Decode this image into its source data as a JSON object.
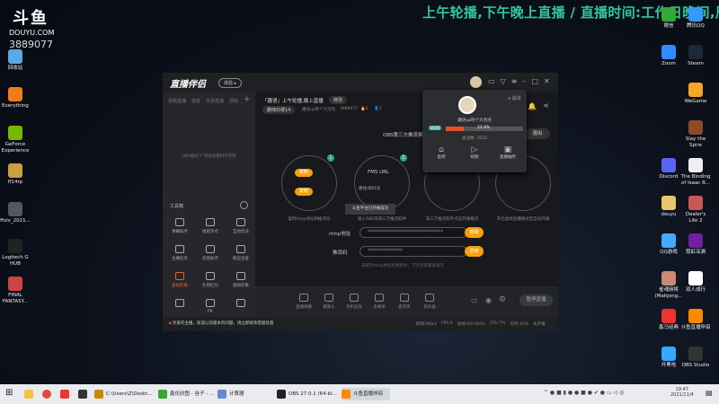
{
  "banner": "上午轮播,下午晚上直播 /  直播时间:工作日晚间,周",
  "logo": {
    "text": "斗鱼",
    "sub": "DOUYU.COM"
  },
  "room_id": "3889077",
  "desktop_left": [
    "回收站",
    "Everything",
    "GeForce Experience",
    "ff14rp",
    "ffxiv_2021...",
    "Logitech G HUB",
    "FINAL FANTASY..."
  ],
  "desktop_right": [
    [
      "微信",
      "腾讯QQ"
    ],
    [
      "Zoom",
      "Steam"
    ],
    [
      "",
      "WeGame"
    ],
    [
      "",
      "Slay the Spire"
    ],
    [
      "Discord",
      "The Binding of Isaac R..."
    ],
    [
      "douyu",
      "Dealer's Life 2"
    ],
    [
      "QQ游戏",
      "霓虹深渊"
    ],
    [
      "雀魂麻将(Mahjong...",
      "双人成行"
    ],
    [
      "鑫马经典",
      "斗鱼直播伴侣"
    ],
    [
      "开黑啦",
      "OBS Studio"
    ]
  ],
  "colors": {
    "accent": "#f6a10c",
    "banner": "#2fc99a",
    "badge": "#2aa37a"
  },
  "app": {
    "title": "直播伴侣",
    "beta": "体验 ▸",
    "left_tabs": [
      "视频直播",
      "语音",
      "手游直播",
      "游戏"
    ],
    "obs_note": "OBS模式下 待添加素材不可用",
    "tools_header": "工具箱",
    "tools": [
      "弹幕助手",
      "福星热点",
      "互动玩法",
      "主播任务",
      "房管助手",
      "粉丝连麦",
      "虚拟形象",
      "礼物红包",
      "虚拟形象",
      "",
      "PK",
      ""
    ],
    "notice": "亲爱的主播，知道以前版本的问题，请立即联系客服处理",
    "stream_title": "「趣语」上午轮播,晚上直播",
    "edit_tag": "修改",
    "category": "趣味红楼14",
    "streamer": "趣语up吹个大泡泡",
    "room": "3889077",
    "fire": "4",
    "viewers": "1",
    "obs_heading": "OBS第三方推流模式",
    "exit": "退出",
    "copy": "复制",
    "fms": "FMS URL",
    "path_label": "路径/串码流",
    "tooltip": "斗鱼平台已开播成功",
    "steps": [
      "复制rtmp地址和推流码",
      "填入OBS等第三方推流软件",
      "第三方推流软件点击开播推流",
      "开启虚拟直播模式后自动开播"
    ],
    "rtmp_label": "rtmp地址",
    "rtmp_value": "****************************",
    "key_label": "推流码",
    "key_value": "*************",
    "hint": "未提示rtmp地址有更新时，下次无需重复填写",
    "bottom": [
      "直播弹幕",
      "摄像头",
      "手机投屏",
      "多媒体",
      "麦克风",
      "扬声器"
    ],
    "start": "暂停直播",
    "status": [
      "网速:0Kb/s",
      "FPS:0",
      "丢帧:0(0.00%)",
      "CPU:7%",
      "内存:16%",
      "未开播"
    ],
    "popup": {
      "name": "趣语up吹个大泡泡",
      "level": "LV.16",
      "progress": "22.8%",
      "progress_value": 22.8,
      "fans": "关注数: 3022",
      "logout": "退出",
      "actions": [
        "鱼吧",
        "视频",
        "直播抽奖"
      ]
    }
  },
  "taskbar": {
    "items": [
      "C:\\Users\\Z\\Deskt...",
      "鑫化欣图 - 谷子 - ...",
      "计算器",
      "OBS 27.0.1 (64-bi...",
      "斗鱼直播伴侣"
    ],
    "time": "19:47",
    "date": "2021/11/4"
  }
}
